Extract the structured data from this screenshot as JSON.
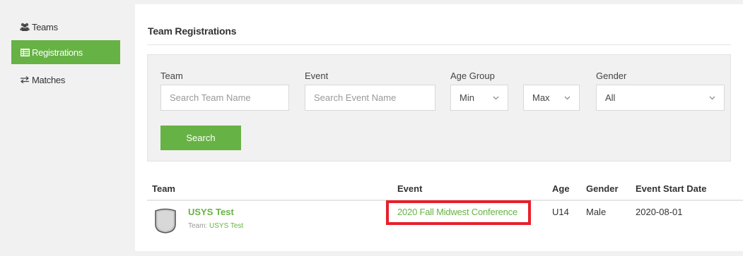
{
  "sidebar": {
    "items": [
      {
        "label": "Teams",
        "icon": "users-icon",
        "active": false
      },
      {
        "label": "Registrations",
        "icon": "list-icon",
        "active": true
      },
      {
        "label": "Matches",
        "icon": "swap-arrows-icon",
        "active": false
      }
    ]
  },
  "page": {
    "title": "Team Registrations"
  },
  "filters": {
    "team_label": "Team",
    "team_placeholder": "Search Team Name",
    "event_label": "Event",
    "event_placeholder": "Search Event Name",
    "age_group_label": "Age Group",
    "age_min": "Min",
    "age_max": "Max",
    "gender_label": "Gender",
    "gender_value": "All",
    "search_button": "Search"
  },
  "table": {
    "headers": [
      "Team",
      "Event",
      "Age",
      "Gender",
      "Event Start Date"
    ],
    "rows": [
      {
        "team": "USYS Test",
        "team_sub_prefix": "Team:",
        "team_sub_value": "USYS Test",
        "event": "2020 Fall Midwest Conference",
        "age": "U14",
        "gender": "Male",
        "start_date": "2020-08-01"
      }
    ]
  },
  "colors": {
    "accent": "#67b245",
    "highlight": "#e8202a"
  }
}
